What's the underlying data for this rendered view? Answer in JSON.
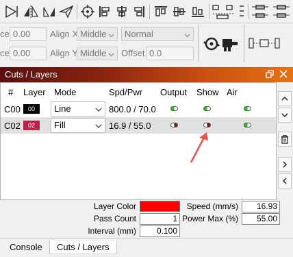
{
  "toolbar": {
    "icons": [
      "align-edge-icon",
      "mirror-icon",
      "send-icon",
      "crosshair-icon",
      "align-left-icon",
      "align-center-icon",
      "align-right-icon",
      "align-top-icon",
      "align-middle-icon",
      "align-bottom-icon",
      "distribute-h-icon",
      "distribute-v-icon"
    ]
  },
  "row2": {
    "space_label_1": "ce",
    "space_value_1": "0.00",
    "align_x_label": "Align X",
    "align_x_value": "Middle",
    "normal_value": "Normal",
    "space_label_2": "ce",
    "space_value_2": "0.00",
    "align_y_label": "Align Y",
    "align_y_value": "Middle",
    "offset_label": "Offset",
    "offset_value": "0.0"
  },
  "panel": {
    "title": "Cuts / Layers",
    "headers": {
      "num": "#",
      "layer": "Layer",
      "mode": "Mode",
      "spdpwr": "Spd/Pwr",
      "output": "Output",
      "show": "Show",
      "air": "Air"
    },
    "rows": [
      {
        "num": "C00",
        "layer": "00",
        "layer_color": "#000000",
        "mode": "Line",
        "spdpwr": "800.0 / 70.0",
        "output": "on",
        "show": "on",
        "air": "on"
      },
      {
        "num": "C02",
        "layer": "02",
        "layer_color": "#b5254a",
        "mode": "Fill",
        "spdpwr": "16.9 / 55.0",
        "output": "off",
        "show": "off",
        "air": "on"
      }
    ]
  },
  "props": {
    "layer_color_label": "Layer Color",
    "layer_color": "#ff0000",
    "speed_label": "Speed (mm/s)",
    "speed_value": "16.93",
    "pass_count_label": "Pass Count",
    "pass_count_value": "1",
    "power_max_label": "Power Max (%)",
    "power_max_value": "55.00",
    "interval_label": "Interval (mm)",
    "interval_value": "0.100"
  },
  "tabs": [
    "Console",
    "Cuts / Layers"
  ],
  "colors": {
    "toggle_on": "#22c522",
    "toggle_off": "#7a1a1a",
    "arrow": "#e8524a"
  }
}
